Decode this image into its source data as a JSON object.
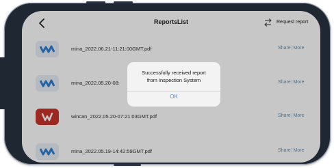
{
  "header": {
    "back_icon": "chevron-left-icon",
    "title": "ReportsList",
    "request_icon": "swap-arrows-icon",
    "request_label": "Request report"
  },
  "reports": [
    {
      "name": "mina_2022.06.21-11:21:00GMT.pdf",
      "icon": "wave-logo-icon",
      "share": "Share",
      "more": "More"
    },
    {
      "name": "mina_2022.05.20-08:",
      "icon": "wave-logo-icon",
      "share": "Share",
      "more": "More"
    },
    {
      "name": "wincan_2022.05.20-07:21:03GMT.pdf",
      "icon": "wincan-logo-icon",
      "share": "Share",
      "more": "More"
    },
    {
      "name": "mina_2022.05.19-14:42:59GMT.pdf",
      "icon": "wave-logo-icon",
      "share": "Share",
      "more": "More"
    }
  ],
  "alert": {
    "line1": "Successfully received report",
    "line2": "from Inspection System",
    "button": "OK"
  },
  "colors": {
    "accent": "#3a8ee6",
    "link": "#4c97d6",
    "wincan_red": "#c9342c",
    "wave_blue": "#2f7fd1"
  }
}
